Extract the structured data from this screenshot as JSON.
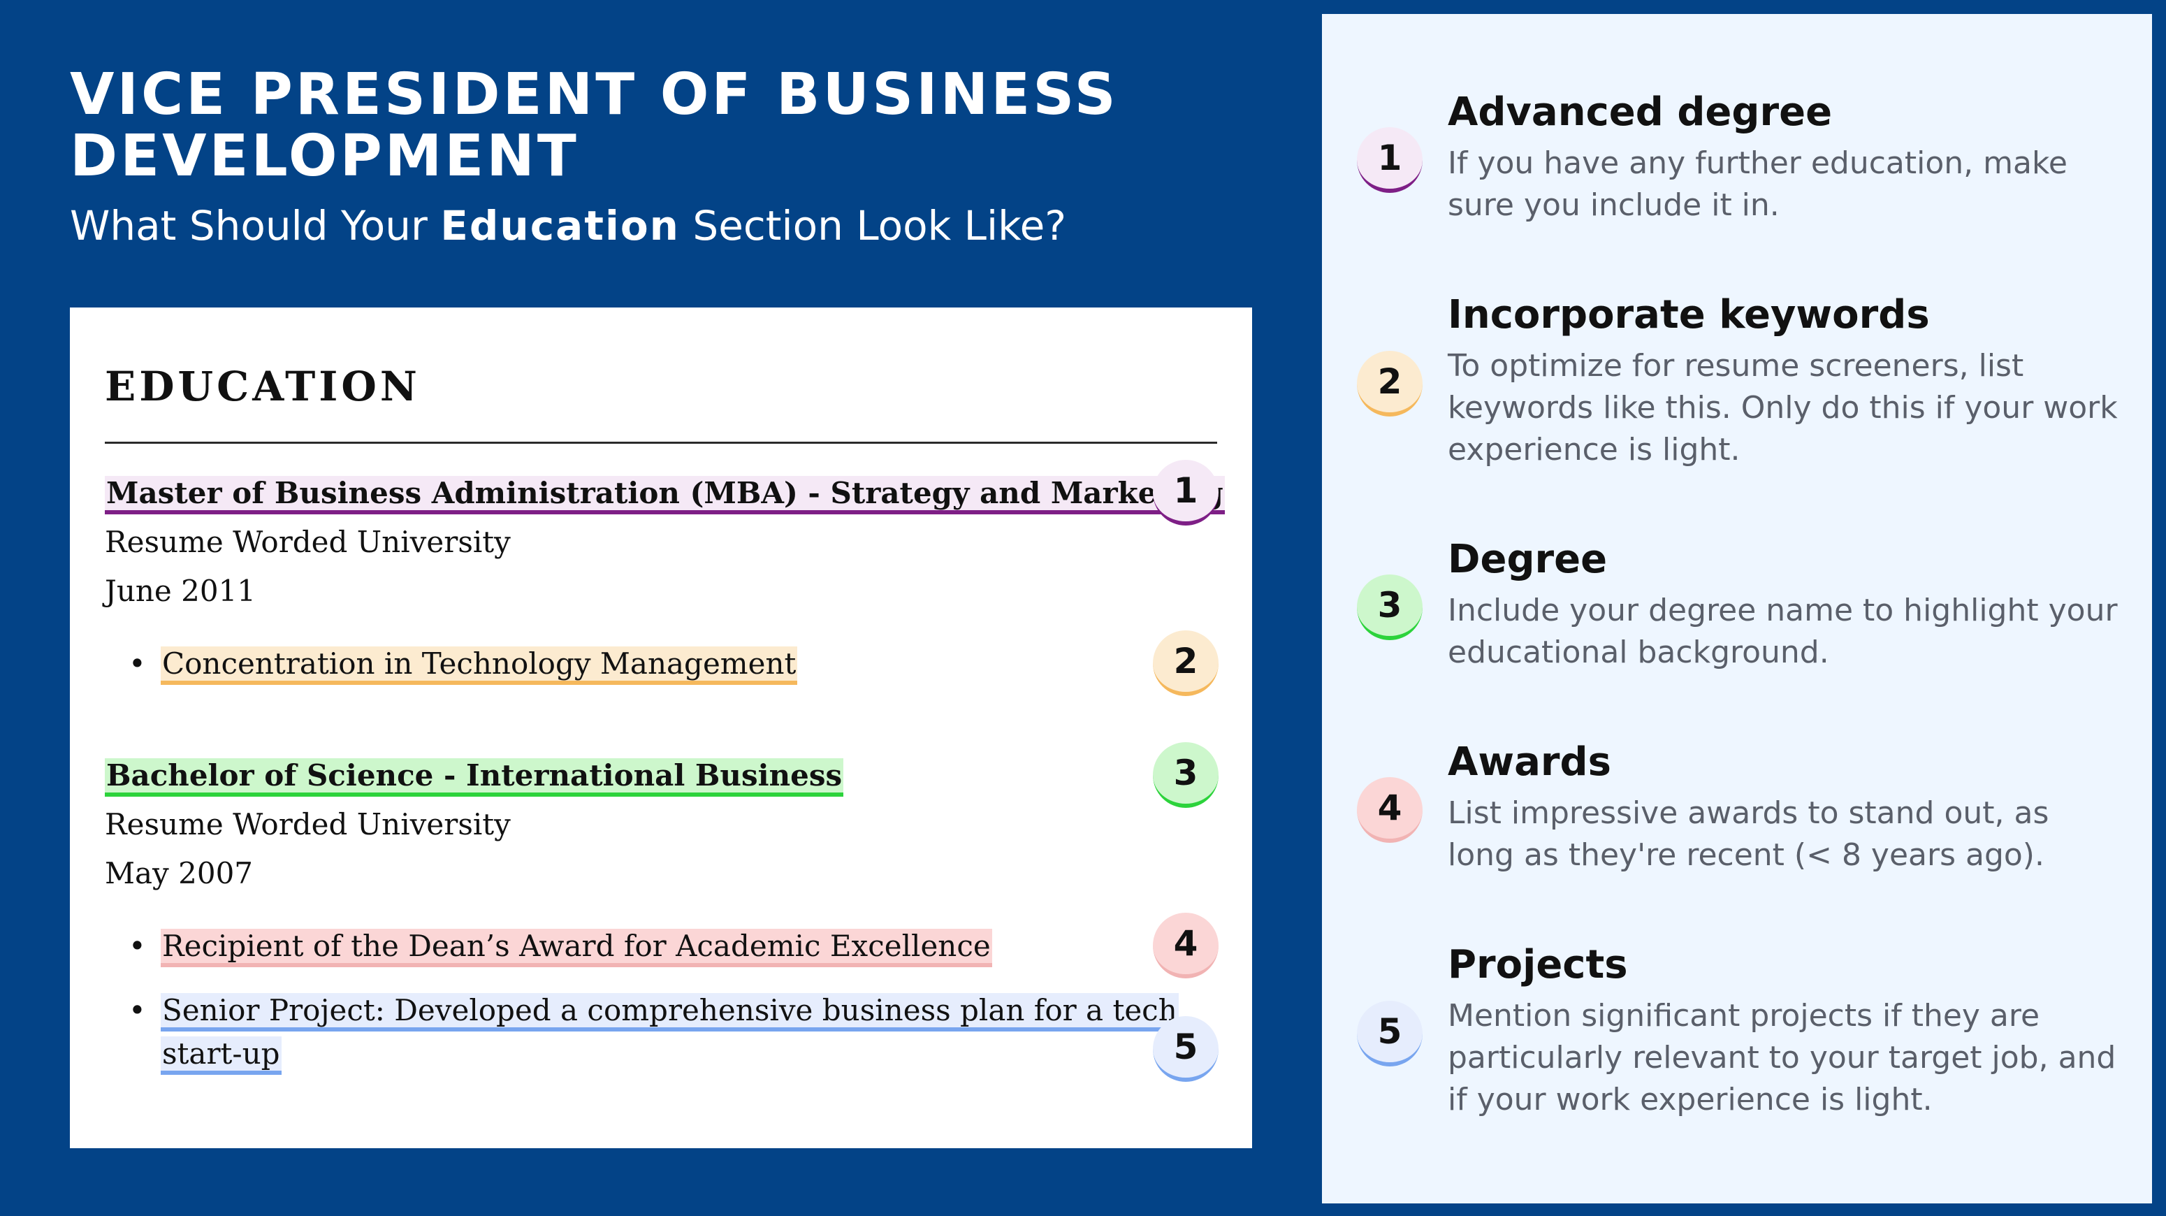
{
  "header": {
    "title": "VICE PRESIDENT OF BUSINESS DEVELOPMENT",
    "subtitle_before": "What Should Your ",
    "subtitle_bold": "Education",
    "subtitle_after": " Section Look Like?"
  },
  "resume": {
    "section_heading": "EDUCATION",
    "entries": [
      {
        "degree": "Master of Business Administration (MBA) - Strategy and Marketing",
        "school": "Resume Worded University",
        "date": "June 2011",
        "bullets": [
          "Concentration in Technology Management"
        ]
      },
      {
        "degree": "Bachelor of Science - International Business",
        "school": "Resume Worded University",
        "date": "May 2007",
        "bullets": [
          "Recipient of the Dean’s Award for Academic Excellence",
          "Senior Project: Developed a comprehensive business plan for a tech start-up"
        ],
        "bullet_2_line_1": "Senior Project: Developed a comprehensive business plan for a tech",
        "bullet_2_line_2": "start-up"
      }
    ]
  },
  "badges": [
    "1",
    "2",
    "3",
    "4",
    "5"
  ],
  "tips": [
    {
      "number": "1",
      "title": "Advanced degree",
      "description": "If you have any further education, make sure you include it in."
    },
    {
      "number": "2",
      "title": "Incorporate keywords",
      "description": "To optimize for resume screeners, list keywords like this. Only do this if your work experience is light."
    },
    {
      "number": "3",
      "title": "Degree",
      "description": "Include your degree name to highlight your educational background."
    },
    {
      "number": "4",
      "title": "Awards",
      "description": "List impressive awards to stand out, as long as they're recent (< 8 years ago)."
    },
    {
      "number": "5",
      "title": "Projects",
      "description": "Mention significant projects if they are particularly relevant to your target job, and if your work experience is light."
    }
  ],
  "colors": {
    "background": "#034387",
    "panel": "#eef6ff",
    "tip_1": "#7e1f86",
    "tip_2": "#f5b85c",
    "tip_3": "#2cd33b",
    "tip_4": "#f1b3b3",
    "tip_5": "#78a5ef"
  }
}
